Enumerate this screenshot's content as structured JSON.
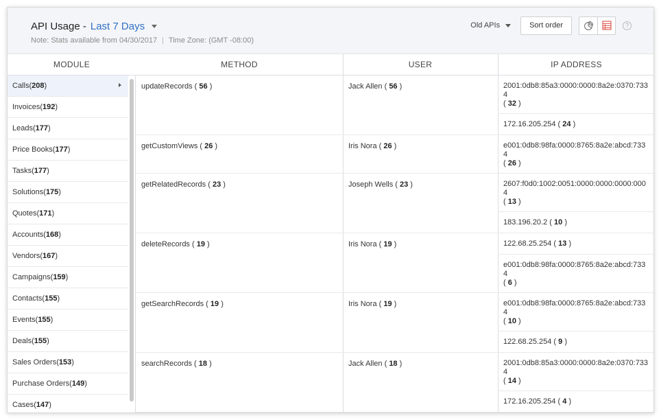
{
  "header": {
    "title": "API Usage -",
    "period": "Last 7 Days",
    "note": "Note: Stats available from 04/30/2017",
    "separator": "|",
    "timezone": "Time Zone: (GMT -08:00)",
    "old_apis": "Old APIs",
    "sort_order": "Sort order",
    "help": "?"
  },
  "columns": {
    "module": "MODULE",
    "method": "METHOD",
    "user": "USER",
    "ip": "IP ADDRESS"
  },
  "modules": [
    {
      "name": "Calls",
      "count": "208",
      "active": true
    },
    {
      "name": "Invoices",
      "count": "192"
    },
    {
      "name": "Leads",
      "count": "177"
    },
    {
      "name": "Price Books",
      "count": "177"
    },
    {
      "name": "Tasks",
      "count": "177"
    },
    {
      "name": "Solutions",
      "count": "175"
    },
    {
      "name": "Quotes",
      "count": "171"
    },
    {
      "name": "Accounts",
      "count": "168"
    },
    {
      "name": "Vendors",
      "count": "167"
    },
    {
      "name": "Campaigns",
      "count": "159"
    },
    {
      "name": "Contacts",
      "count": "155"
    },
    {
      "name": "Events",
      "count": "155"
    },
    {
      "name": "Deals",
      "count": "155"
    },
    {
      "name": "Sales Orders",
      "count": "153"
    },
    {
      "name": "Purchase Orders",
      "count": "149"
    },
    {
      "name": "Cases",
      "count": "147"
    }
  ],
  "rows": [
    {
      "method": "updateRecords",
      "method_count": "56",
      "user": "Jack Allen",
      "user_count": "56",
      "ips": [
        {
          "addr": "2001:0db8:85a3:0000:0000:8a2e:0370:7334",
          "count": "32",
          "wrap": true
        },
        {
          "addr": "172.16.205.254",
          "count": "24",
          "wrap": false
        }
      ]
    },
    {
      "method": "getCustomViews",
      "method_count": "26",
      "user": "Iris Nora",
      "user_count": "26",
      "ips": [
        {
          "addr": "e001:0db8:98fa:0000:8765:8a2e:abcd:7334",
          "count": "26",
          "wrap": true
        }
      ]
    },
    {
      "method": "getRelatedRecords",
      "method_count": "23",
      "user": "Joseph Wells",
      "user_count": "23",
      "ips": [
        {
          "addr": "2607:f0d0:1002:0051:0000:0000:0000:0004",
          "count": "13",
          "wrap": true
        },
        {
          "addr": "183.196.20.2",
          "count": "10",
          "wrap": false
        }
      ]
    },
    {
      "method": "deleteRecords",
      "method_count": "19",
      "user": "Iris Nora",
      "user_count": "19",
      "ips": [
        {
          "addr": "122.68.25.254",
          "count": "13",
          "wrap": false
        },
        {
          "addr": "e001:0db8:98fa:0000:8765:8a2e:abcd:7334",
          "count": "6",
          "wrap": true
        }
      ]
    },
    {
      "method": "getSearchRecords",
      "method_count": "19",
      "user": "Iris Nora",
      "user_count": "19",
      "ips": [
        {
          "addr": "e001:0db8:98fa:0000:8765:8a2e:abcd:7334",
          "count": "10",
          "wrap": true
        },
        {
          "addr": "122.68.25.254",
          "count": "9",
          "wrap": false
        }
      ]
    },
    {
      "method": "searchRecords",
      "method_count": "18",
      "user": "Jack Allen",
      "user_count": "18",
      "ips": [
        {
          "addr": "2001:0db8:85a3:0000:0000:8a2e:0370:7334",
          "count": "14",
          "wrap": true
        },
        {
          "addr": "172.16.205.254",
          "count": "4",
          "wrap": false
        }
      ]
    }
  ],
  "colors": {
    "accent": "#2f6fc5",
    "chart_icon": "#777777",
    "table_icon": "#e05a4f"
  }
}
